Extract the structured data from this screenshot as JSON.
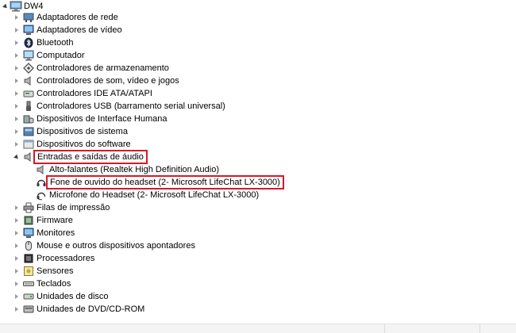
{
  "root": {
    "label": "DW4",
    "icon": "computer-icon"
  },
  "categories": [
    {
      "label": "Adaptadores de rede",
      "icon": "network-adapter-icon"
    },
    {
      "label": "Adaptadores de vídeo",
      "icon": "display-adapter-icon"
    },
    {
      "label": "Bluetooth",
      "icon": "bluetooth-icon"
    },
    {
      "label": "Computador",
      "icon": "monitor-icon"
    },
    {
      "label": "Controladores de armazenamento",
      "icon": "storage-controller-icon"
    },
    {
      "label": "Controladores de som, vídeo e jogos",
      "icon": "speaker-icon"
    },
    {
      "label": "Controladores IDE ATA/ATAPI",
      "icon": "ide-controller-icon"
    },
    {
      "label": "Controladores USB (barramento serial universal)",
      "icon": "usb-icon"
    },
    {
      "label": "Dispositivos de Interface Humana",
      "icon": "hid-icon"
    },
    {
      "label": "Dispositivos de sistema",
      "icon": "system-device-icon"
    },
    {
      "label": "Dispositivos do software",
      "icon": "software-device-icon"
    },
    {
      "label": "Entradas e saídas de áudio",
      "icon": "audio-io-icon",
      "expanded": true,
      "highlighted": true,
      "children": [
        {
          "label": "Alto-falantes (Realtek High Definition Audio)",
          "icon": "speaker-icon"
        },
        {
          "label": "Fone de ouvido do headset (2- Microsoft LifeChat LX-3000)",
          "icon": "headset-icon",
          "highlighted": true
        },
        {
          "label": "Microfone do Headset (2- Microsoft LifeChat LX-3000)",
          "icon": "microphone-icon"
        }
      ]
    },
    {
      "label": "Filas de impressão",
      "icon": "printer-icon"
    },
    {
      "label": "Firmware",
      "icon": "firmware-icon"
    },
    {
      "label": "Monitores",
      "icon": "monitor-icon"
    },
    {
      "label": "Mouse e outros dispositivos apontadores",
      "icon": "mouse-icon"
    },
    {
      "label": "Processadores",
      "icon": "processor-icon"
    },
    {
      "label": "Sensores",
      "icon": "sensor-icon"
    },
    {
      "label": "Teclados",
      "icon": "keyboard-icon"
    },
    {
      "label": "Unidades de disco",
      "icon": "disk-drive-icon"
    },
    {
      "label": "Unidades de DVD/CD-ROM",
      "icon": "dvd-drive-icon"
    }
  ],
  "colors": {
    "highlight_border": "#d8182a"
  }
}
